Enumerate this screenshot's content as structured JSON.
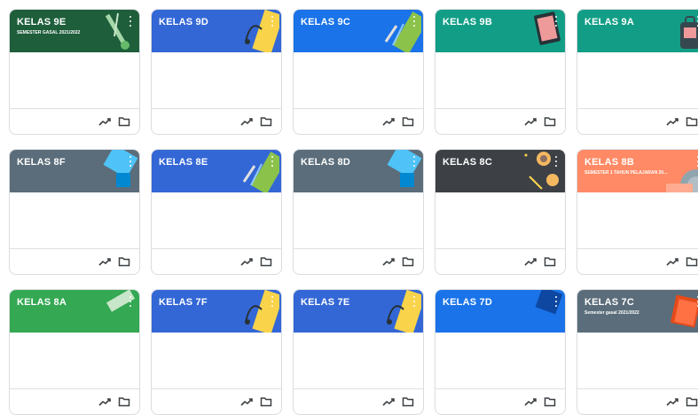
{
  "icons": {
    "menu": "more-vert-icon",
    "insights": "trending-up-icon",
    "folder": "folder-icon"
  },
  "cards": [
    {
      "title": "KELAS 9E",
      "subtitle": "SEMESTER GASAL 2021/2022",
      "color": "#1e5e3b",
      "deco": "tools"
    },
    {
      "title": "KELAS 9D",
      "subtitle": "",
      "color": "#3367d6",
      "deco": "headphones"
    },
    {
      "title": "KELAS 9C",
      "subtitle": "",
      "color": "#1a73e8",
      "deco": "pencils"
    },
    {
      "title": "KELAS 9B",
      "subtitle": "",
      "color": "#129e86",
      "deco": "phone"
    },
    {
      "title": "KELAS 9A",
      "subtitle": "",
      "color": "#129e86",
      "deco": "bag"
    },
    {
      "title": "KELAS 8F",
      "subtitle": "",
      "color": "#5b6d7a",
      "deco": "book-blue"
    },
    {
      "title": "KELAS 8E",
      "subtitle": "",
      "color": "#3367d6",
      "deco": "pencils"
    },
    {
      "title": "KELAS 8D",
      "subtitle": "",
      "color": "#5b6d7a",
      "deco": "book-blue"
    },
    {
      "title": "KELAS 8C",
      "subtitle": "",
      "color": "#3d4146",
      "deco": "coffee"
    },
    {
      "title": "KELAS 8B",
      "subtitle": "SEMESTER 1 TAHUN PELAJARAN 20...",
      "color": "#ff8a65",
      "deco": "record"
    },
    {
      "title": "KELAS 8A",
      "subtitle": "",
      "color": "#34a853",
      "deco": "ruler"
    },
    {
      "title": "KELAS 7F",
      "subtitle": "",
      "color": "#3367d6",
      "deco": "headphones"
    },
    {
      "title": "KELAS 7E",
      "subtitle": "",
      "color": "#3367d6",
      "deco": "headphones"
    },
    {
      "title": "KELAS 7D",
      "subtitle": "",
      "color": "#1a73e8",
      "deco": "blueblock"
    },
    {
      "title": "KELAS 7C",
      "subtitle": "Semester gasal 2021/2022",
      "color": "#5b6d7a",
      "deco": "book-red"
    }
  ]
}
